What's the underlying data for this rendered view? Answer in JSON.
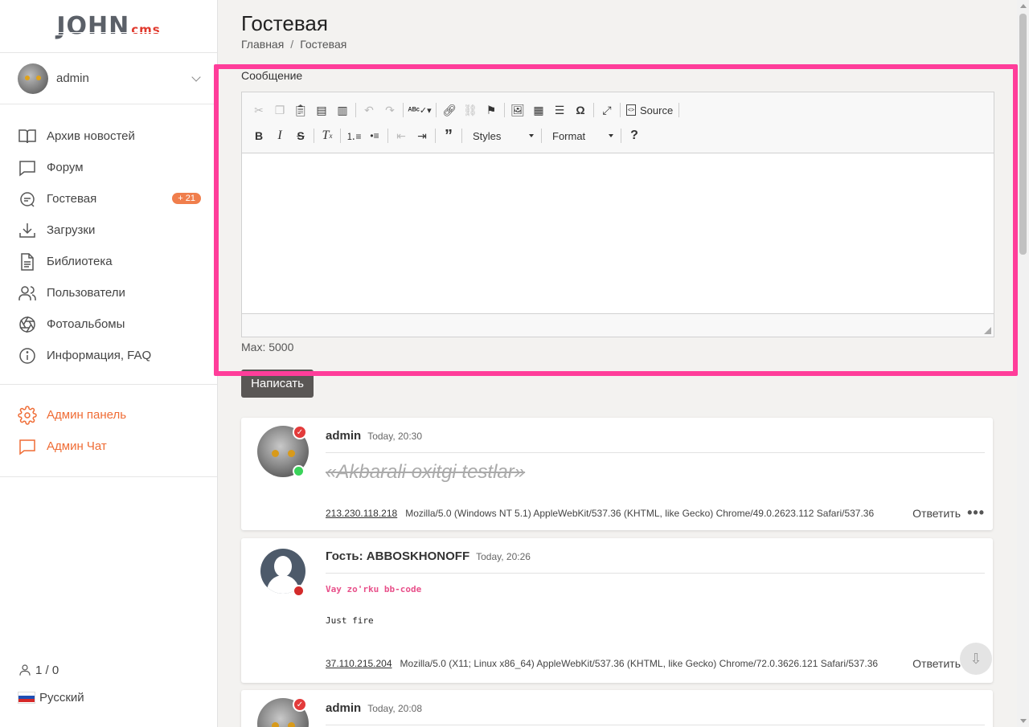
{
  "brand": {
    "logo_main": "JOHN",
    "logo_sub": "cms"
  },
  "user": {
    "name": "admin"
  },
  "nav": [
    {
      "label": "Архив новостей",
      "icon": "book-icon"
    },
    {
      "label": "Форум",
      "icon": "chat-icon"
    },
    {
      "label": "Гостевая",
      "icon": "guestbook-icon",
      "badge": "+ 21"
    },
    {
      "label": "Загрузки",
      "icon": "download-icon"
    },
    {
      "label": "Библиотека",
      "icon": "document-icon"
    },
    {
      "label": "Пользователи",
      "icon": "users-icon"
    },
    {
      "label": "Фотоальбомы",
      "icon": "aperture-icon"
    },
    {
      "label": "Информация, FAQ",
      "icon": "info-icon"
    }
  ],
  "admin_nav": [
    {
      "label": "Админ панель",
      "icon": "gear-icon"
    },
    {
      "label": "Админ Чат",
      "icon": "chat-icon"
    }
  ],
  "footer": {
    "online": "1 / 0",
    "language": "Русский"
  },
  "page": {
    "title": "Гостевая",
    "breadcrumb": [
      "Главная",
      "Гостевая"
    ]
  },
  "form": {
    "label": "Сообщение",
    "max_note": "Max: 5000",
    "submit_label": "Написать",
    "toolbar": {
      "source_label": "Source",
      "styles_label": "Styles",
      "format_label": "Format"
    }
  },
  "posts": [
    {
      "author": "admin",
      "time": "Today, 20:30",
      "quote": "«Akbarali oxitgi testlar»",
      "ip": "213.230.118.218",
      "ua": "Mozilla/5.0 (Windows NT 5.1) AppleWebKit/537.36 (KHTML, like Gecko) Chrome/49.0.2623.112 Safari/537.36",
      "reply": "Ответить"
    },
    {
      "author": "Гость: ABBOSKHONOFF",
      "time": "Today, 20:26",
      "code_pink": "Vay zo'rku bb-code",
      "code_plain": "Just fire",
      "ip": "37.110.215.204",
      "ua": "Mozilla/5.0 (X11; Linux x86_64) AppleWebKit/537.36 (KHTML, like Gecko) Chrome/72.0.3626.121 Safari/537.36",
      "reply": "Ответить"
    },
    {
      "author": "admin",
      "time": "Today, 20:08"
    }
  ],
  "colors": {
    "accent": "#ef6c35",
    "highlight": "#ff3d9a",
    "online": "#3ad35a",
    "offline": "#d32b2b",
    "code_pink": "#e8508a"
  }
}
